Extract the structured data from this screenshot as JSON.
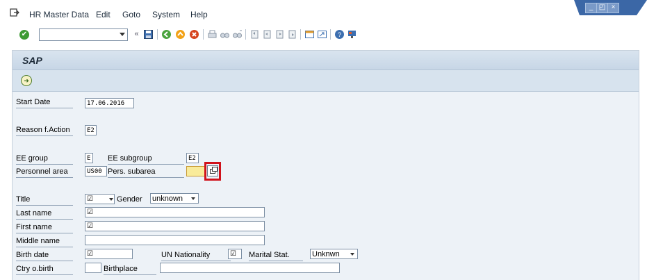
{
  "menu": {
    "items": [
      "HR Master Data",
      "Edit",
      "Goto",
      "System",
      "Help"
    ]
  },
  "window_controls": {
    "minimize": "_",
    "restore": "◰",
    "close": "×"
  },
  "toolbar": {
    "command_field_value": "",
    "icons": [
      "enter-icon",
      "back-double-icon",
      "save-icon",
      "back-icon",
      "exit-icon",
      "cancel-icon",
      "print-icon",
      "find-icon",
      "find-next-icon",
      "first-page-icon",
      "previous-page-icon",
      "next-page-icon",
      "last-page-icon",
      "create-session-icon",
      "shortcut-icon",
      "help-icon",
      "customize-layout-icon"
    ]
  },
  "screen": {
    "title": "SAP"
  },
  "form": {
    "start_date": {
      "label": "Start Date",
      "value": "17.06.2016"
    },
    "reason": {
      "label": "Reason f.Action",
      "value": "E2"
    },
    "ee_group": {
      "label": "EE group",
      "value": "E"
    },
    "ee_subgroup": {
      "label": "EE subgroup",
      "value": "E2"
    },
    "personnel_area": {
      "label": "Personnel area",
      "value": "US00"
    },
    "pers_subarea": {
      "label": "Pers. subarea",
      "value": ""
    },
    "title": {
      "label": "Title",
      "value": "☑"
    },
    "gender": {
      "label": "Gender",
      "value": "unknown"
    },
    "last_name": {
      "label": "Last name",
      "value": "☑"
    },
    "first_name": {
      "label": "First name",
      "value": "☑"
    },
    "middle_name": {
      "label": "Middle name",
      "value": ""
    },
    "birth_date": {
      "label": "Birth date",
      "value": "☑"
    },
    "un_nationality": {
      "label": "UN Nationality",
      "value": "☑"
    },
    "marital_stat": {
      "label": "Marital Stat.",
      "value": "Unknwn"
    },
    "ctry_birth": {
      "label": "Ctry o.birth",
      "value": ""
    },
    "birthplace": {
      "label": "Birthplace",
      "value": ""
    }
  }
}
